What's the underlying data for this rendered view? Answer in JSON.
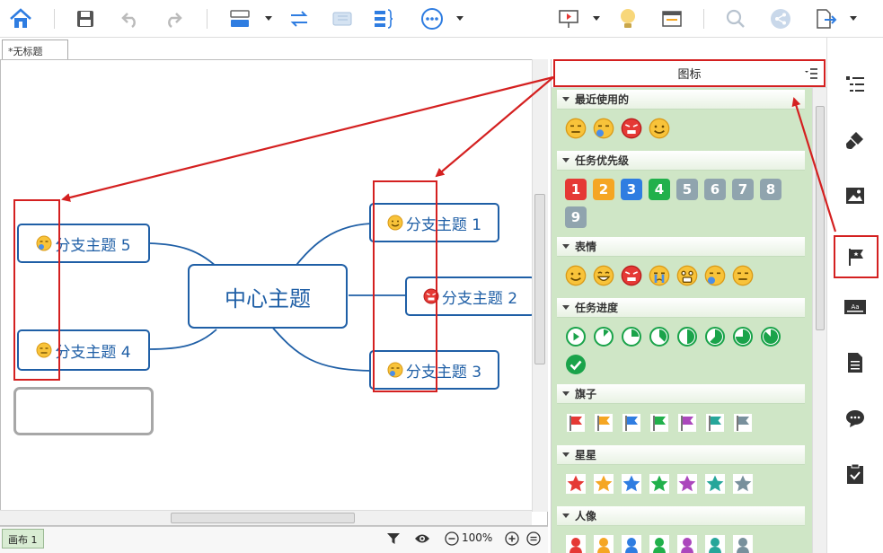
{
  "toolbar": {
    "icons": [
      "home-icon",
      "save-icon",
      "undo-icon",
      "redo-icon",
      "layout-icon",
      "swap-icon",
      "outline-icon",
      "brace-icon",
      "more-icon",
      "presentation-icon",
      "idea-icon",
      "window-icon",
      "search-icon",
      "share-icon",
      "export-icon"
    ]
  },
  "tab": {
    "doc_title": "*无标题"
  },
  "map": {
    "central": "中心主题",
    "topics": [
      {
        "label": "分支主题 1",
        "emoji": "smile"
      },
      {
        "label": "分支主题 2",
        "emoji": "angry"
      },
      {
        "label": "分支主题 3",
        "emoji": "sleepy"
      },
      {
        "label": "分支主题 4",
        "emoji": "meh"
      },
      {
        "label": "分支主题 5",
        "emoji": "sleepy"
      }
    ]
  },
  "status": {
    "sheet": "画布 1",
    "zoom": "100%"
  },
  "panel": {
    "title": "图标",
    "sections": [
      {
        "title": "最近使用的"
      },
      {
        "title": "任务优先级",
        "numbers": [
          "1",
          "2",
          "3",
          "4",
          "5",
          "6",
          "7",
          "8",
          "9"
        ]
      },
      {
        "title": "表情"
      },
      {
        "title": "任务进度"
      },
      {
        "title": "旗子"
      },
      {
        "title": "星星"
      },
      {
        "title": "人像"
      }
    ]
  },
  "colors": {
    "topic_border": "#1f5fa6",
    "panel_bg": "#cfe6c6",
    "annotation_red": "#d42020",
    "priority": [
      "#e53935",
      "#f5a623",
      "#2f7de1",
      "#21b04b",
      "#90a4ae",
      "#90a4ae",
      "#90a4ae",
      "#90a4ae",
      "#90a4ae"
    ],
    "flags": [
      "#e53935",
      "#f5a623",
      "#2f7de1",
      "#21b04b",
      "#ab47bc",
      "#26a69a",
      "#78909c"
    ]
  },
  "sidebar": {
    "icons": [
      "outline-list-icon",
      "format-brush-icon",
      "image-icon",
      "marker-flag-icon",
      "text-style-icon",
      "notes-icon",
      "comment-icon",
      "task-icon"
    ]
  }
}
